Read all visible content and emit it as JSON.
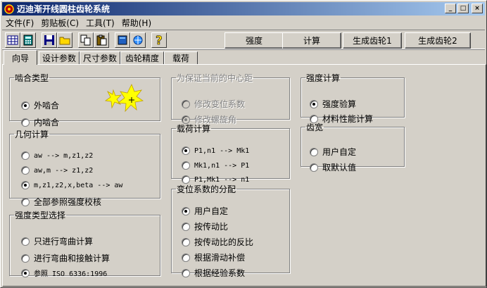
{
  "app": {
    "title": "迈迪渐开线圆柱齿轮系统"
  },
  "window_buttons": {
    "minimize": "_",
    "maximize": "□",
    "close": "×"
  },
  "menu": [
    "文件(F)",
    "剪贴板(C)",
    "工具(T)",
    "帮助(H)"
  ],
  "toolbar": {
    "icons": [
      "table-icon",
      "calculator-icon",
      "save-icon",
      "open-folder-icon",
      "copy-icon",
      "paste-icon",
      "book-icon",
      "browser-icon",
      "help-icon"
    ],
    "buttons": [
      "强度",
      "计算",
      "生成齿轮1",
      "生成齿轮2"
    ]
  },
  "tabs": [
    {
      "label": "向导",
      "active": true
    },
    {
      "label": "设计参数"
    },
    {
      "label": "尺寸参数"
    },
    {
      "label": "齿轮精度"
    },
    {
      "label": "载荷"
    }
  ],
  "groups": {
    "mesh": {
      "title": "啮合类型",
      "options": [
        {
          "label": "外啮合",
          "checked": true
        },
        {
          "label": "内啮合"
        }
      ]
    },
    "geometry": {
      "title": "几何计算",
      "options": [
        {
          "label": "aw --> m,z1,z2"
        },
        {
          "label": "aw,m --> z1,z2"
        },
        {
          "label": "m,z1,z2,x,beta --> aw",
          "checked": true
        },
        {
          "label": "全部参照强度校核"
        }
      ]
    },
    "strength_type": {
      "title": "强度类型选择",
      "options": [
        {
          "label": "只进行弯曲计算"
        },
        {
          "label": "进行弯曲和接触计算"
        },
        {
          "label": "参照 ISO 6336:1996",
          "checked": true
        }
      ]
    },
    "center": {
      "title": "为保证当前的中心距",
      "options": [
        {
          "label": "修改变位系数"
        },
        {
          "label": "修改螺旋角",
          "checked": true
        }
      ]
    },
    "load": {
      "title": "载荷计算",
      "options": [
        {
          "label": "P1,n1 --> Mk1",
          "checked": true
        },
        {
          "label": "Mk1,n1 --> P1"
        },
        {
          "label": "P1,Mk1 --> n1"
        }
      ]
    },
    "shift": {
      "title": "变位系数的分配",
      "options": [
        {
          "label": "用户自定",
          "checked": true
        },
        {
          "label": "按传动比"
        },
        {
          "label": "按传动比的反比"
        },
        {
          "label": "根据滑动补偿"
        },
        {
          "label": "根据经验系数"
        }
      ]
    },
    "strength_calc": {
      "title": "强度计算",
      "options": [
        {
          "label": "强度验算",
          "checked": true
        },
        {
          "label": "材料性能计算"
        }
      ]
    },
    "width": {
      "title": "齿宽",
      "options": [
        {
          "label": "用户自定"
        },
        {
          "label": "取默认值"
        }
      ]
    }
  }
}
